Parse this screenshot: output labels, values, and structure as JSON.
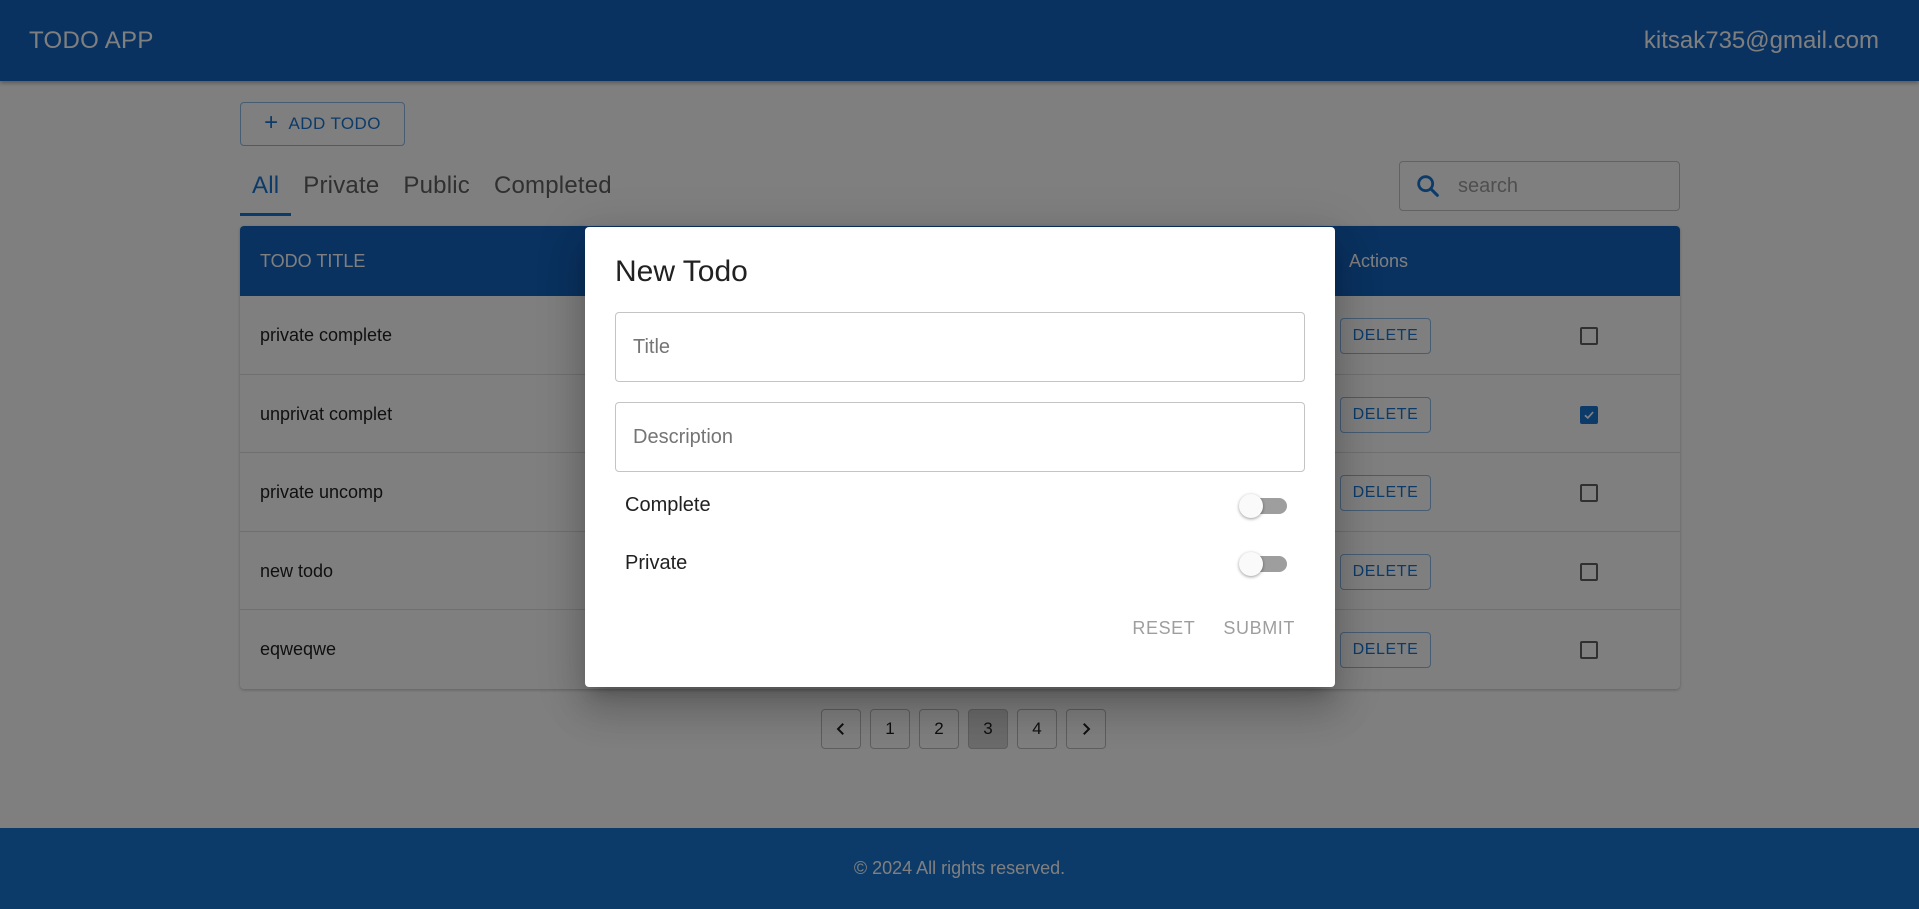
{
  "header": {
    "title": "TODO APP",
    "user_email": "kitsak735@gmail.com"
  },
  "toolbar": {
    "add_label": "ADD TODO",
    "add_icon": "plus-icon"
  },
  "tabs": [
    {
      "label": "All",
      "active": true
    },
    {
      "label": "Private",
      "active": false
    },
    {
      "label": "Public",
      "active": false
    },
    {
      "label": "Completed",
      "active": false
    }
  ],
  "search": {
    "placeholder": "search",
    "icon": "search-icon"
  },
  "table": {
    "headers": {
      "title": "TODO TITLE",
      "actions": "Actions"
    },
    "rows": [
      {
        "title": "private complete",
        "action": "DELETE",
        "checked": false
      },
      {
        "title": "unprivat complet",
        "action": "DELETE",
        "checked": true
      },
      {
        "title": "private uncomp",
        "action": "DELETE",
        "checked": false
      },
      {
        "title": "new todo",
        "action": "DELETE",
        "checked": false
      },
      {
        "title": "eqweqwe",
        "action": "DELETE",
        "checked": false
      }
    ]
  },
  "pagination": {
    "pages": [
      "1",
      "2",
      "3",
      "4"
    ],
    "current": "3"
  },
  "footer": {
    "text": "© 2024 All rights reserved."
  },
  "dialog": {
    "title": "New Todo",
    "title_placeholder": "Title",
    "description_placeholder": "Description",
    "complete_label": "Complete",
    "complete_on": false,
    "private_label": "Private",
    "private_on": false,
    "reset_label": "RESET",
    "submit_label": "SUBMIT"
  },
  "colors": {
    "primary": "#1565c0",
    "accent": "#1976d2"
  }
}
